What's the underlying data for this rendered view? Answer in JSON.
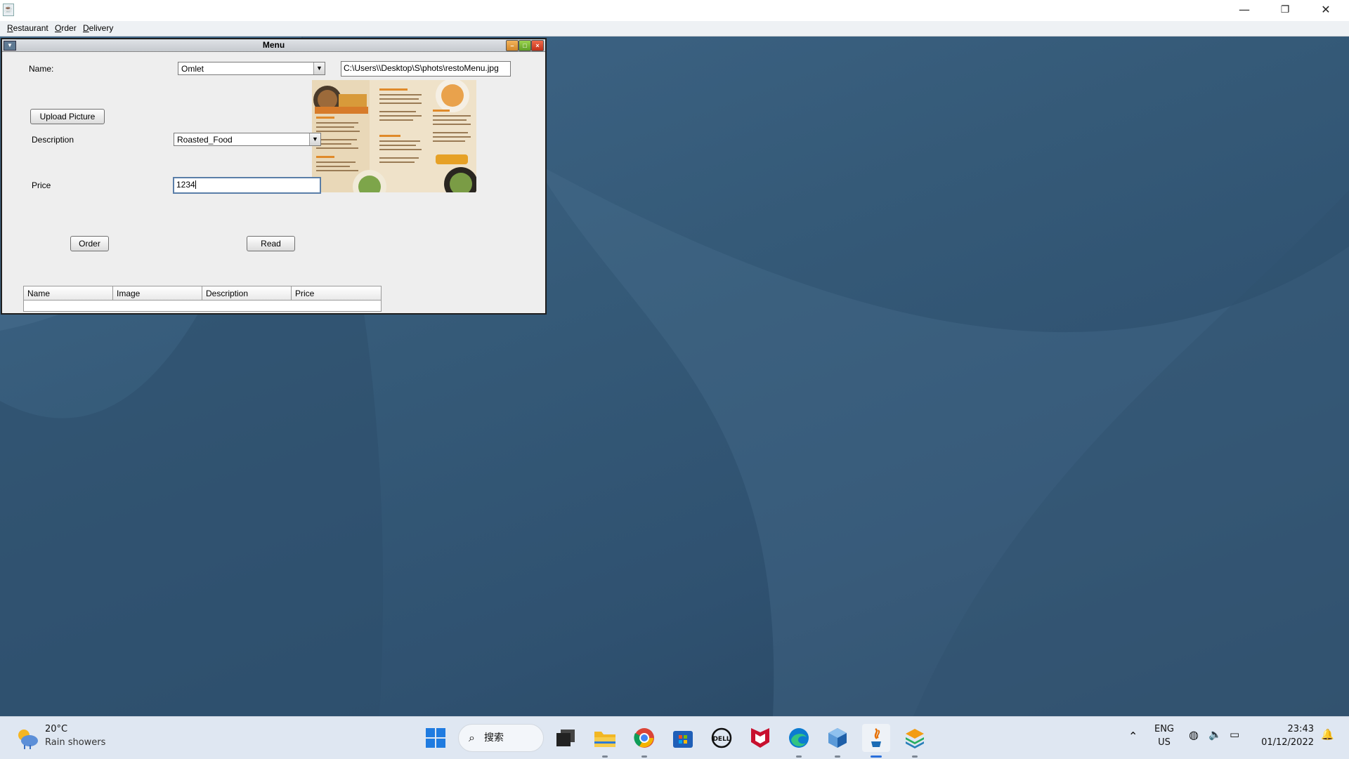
{
  "window": {
    "menu": [
      "Restaurant",
      "Order",
      "Delivery"
    ],
    "controls": {
      "minimize": "—",
      "restore": "❐",
      "close": "✕"
    }
  },
  "internal_frame": {
    "title": "Menu",
    "form": {
      "name_label": "Name:",
      "name_value": "Omlet",
      "path_value": "C:\\Users\\\\Desktop\\S\\phots\\restoMenu.jpg",
      "upload_label": "Upload Picture",
      "description_label": "Description",
      "description_value": "Roasted_Food",
      "price_label": "Price",
      "price_value": "1234"
    },
    "buttons": {
      "order": "Order",
      "read": "Read"
    },
    "table": {
      "columns": [
        "Name",
        "Image",
        "Description",
        "Price"
      ]
    }
  },
  "taskbar": {
    "weather": {
      "temp": "20°C",
      "condition": "Rain showers"
    },
    "search_label": "搜索",
    "apps": [
      "start-icon",
      "task-view-icon",
      "file-explorer-icon",
      "chrome-icon",
      "store-icon",
      "dell-icon",
      "mcafee-icon",
      "edge-icon",
      "virtualbox-icon",
      "java-icon",
      "layers-app-icon"
    ],
    "tray": {
      "lang1": "ENG",
      "lang2": "US",
      "time": "23:43",
      "date": "01/12/2022"
    }
  }
}
